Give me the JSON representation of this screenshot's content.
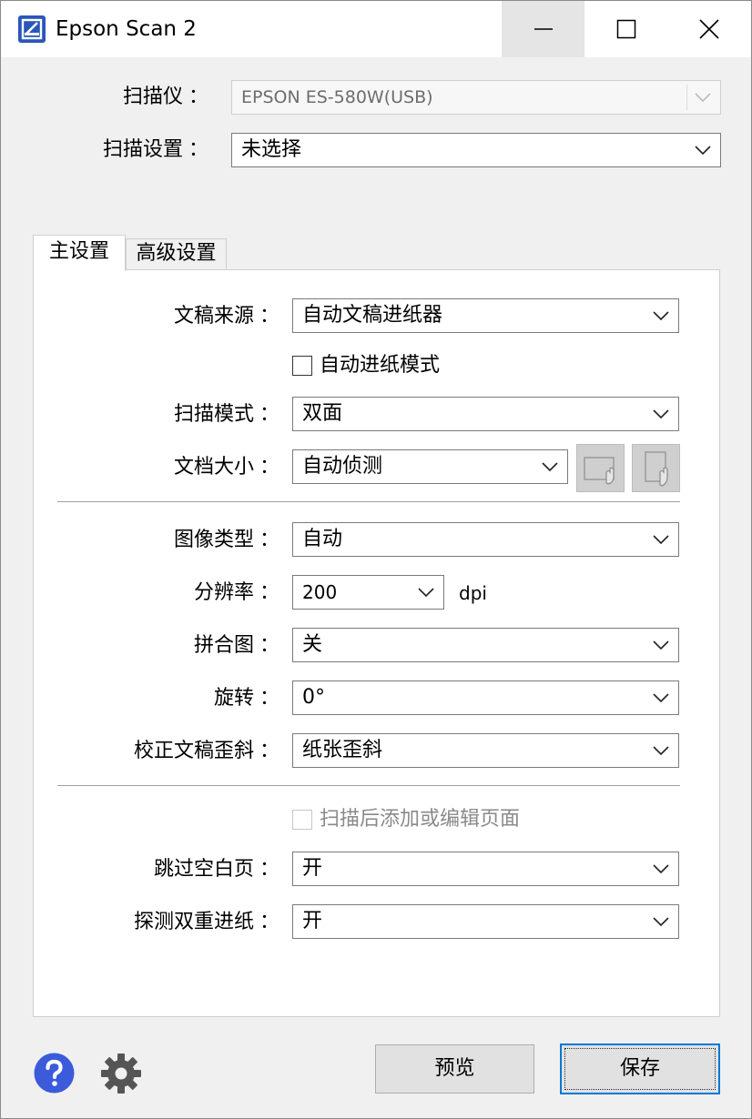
{
  "window": {
    "title": "Epson Scan 2"
  },
  "scanner": {
    "label": "扫描仪",
    "value": "EPSON ES-580W(USB)"
  },
  "scan_settings": {
    "label": "扫描设置",
    "value": "未选择"
  },
  "tabs": [
    {
      "label": "主设置",
      "active": true
    },
    {
      "label": "高级设置",
      "active": false
    }
  ],
  "main": {
    "document_source": {
      "label": "文稿来源",
      "value": "自动文稿进纸器"
    },
    "auto_feed_mode": {
      "label": "自动进纸模式",
      "checked": false
    },
    "scan_mode": {
      "label": "扫描模式",
      "value": "双面"
    },
    "document_size": {
      "label": "文档大小",
      "value": "自动侦测"
    },
    "image_type": {
      "label": "图像类型",
      "value": "自动"
    },
    "resolution": {
      "label": "分辨率",
      "value": "200",
      "unit": "dpi"
    },
    "stitch": {
      "label": "拼合图",
      "value": "关"
    },
    "rotate": {
      "label": "旋转",
      "value": "0°"
    },
    "deskew": {
      "label": "校正文稿歪斜",
      "value": "纸张歪斜"
    },
    "add_edit_pages": {
      "label": "扫描后添加或编辑页面",
      "checked": false,
      "enabled": false
    },
    "skip_blank": {
      "label": "跳过空白页",
      "value": "开"
    },
    "double_feed": {
      "label": "探测双重进纸",
      "value": "开"
    }
  },
  "colon": "：",
  "buttons": {
    "preview": "预览",
    "save": "保存"
  },
  "colors": {
    "accent": "#0078d7",
    "help": "#3b5bdb",
    "gear": "#555555"
  }
}
